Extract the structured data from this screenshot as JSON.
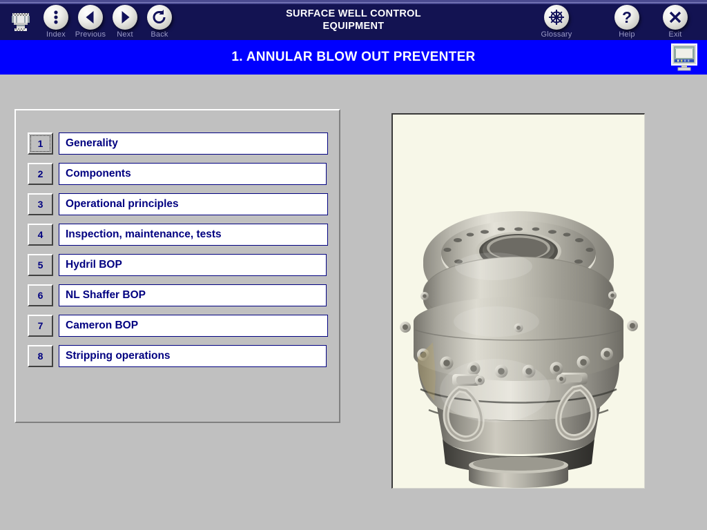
{
  "toolbar": {
    "app_icon": "wellhead-bop-icon",
    "course_title": "SURFACE WELL CONTROL\nEQUIPMENT",
    "course_title_line1": "SURFACE WELL CONTROL",
    "course_title_line2": "EQUIPMENT",
    "background_color": "#131352",
    "label_color": "#9b9bc6",
    "buttons": [
      {
        "label": "Index",
        "icon": "vertical-dots-icon"
      },
      {
        "label": "Previous",
        "icon": "left-triangle-icon"
      },
      {
        "label": "Next",
        "icon": "right-triangle-icon"
      },
      {
        "label": "Back",
        "icon": "undo-arrow-icon"
      },
      {
        "label": "Glossary",
        "icon": "ships-wheel-icon"
      },
      {
        "label": "Help",
        "icon": "question-mark-icon"
      },
      {
        "label": "Exit",
        "icon": "x-close-icon"
      }
    ]
  },
  "titlebar": {
    "page_title": "1. ANNULAR BLOW OUT PREVENTER",
    "background_color": "#0000ff",
    "text_color": "#ffffff",
    "corner_icon": "computer-monitor-icon"
  },
  "menu": {
    "accent_color": "#000080",
    "items": [
      {
        "number": "1",
        "label": "Generality",
        "focused": true
      },
      {
        "number": "2",
        "label": "Components",
        "focused": false
      },
      {
        "number": "3",
        "label": "Operational principles",
        "focused": false
      },
      {
        "number": "4",
        "label": "Inspection, maintenance, tests",
        "focused": false
      },
      {
        "number": "5",
        "label": "Hydril BOP",
        "focused": false
      },
      {
        "number": "6",
        "label": "NL Shaffer BOP",
        "focused": false
      },
      {
        "number": "7",
        "label": "Cameron BOP",
        "focused": false
      },
      {
        "number": "8",
        "label": "Stripping operations",
        "focused": false
      }
    ]
  },
  "illustration": {
    "name": "annular-blow-out-preventer-photo",
    "description": "Photograph of a steel annular blow out preventer body with bolted top flange, lifting shackles and lower connector",
    "background_color": "#f7f7e8"
  }
}
